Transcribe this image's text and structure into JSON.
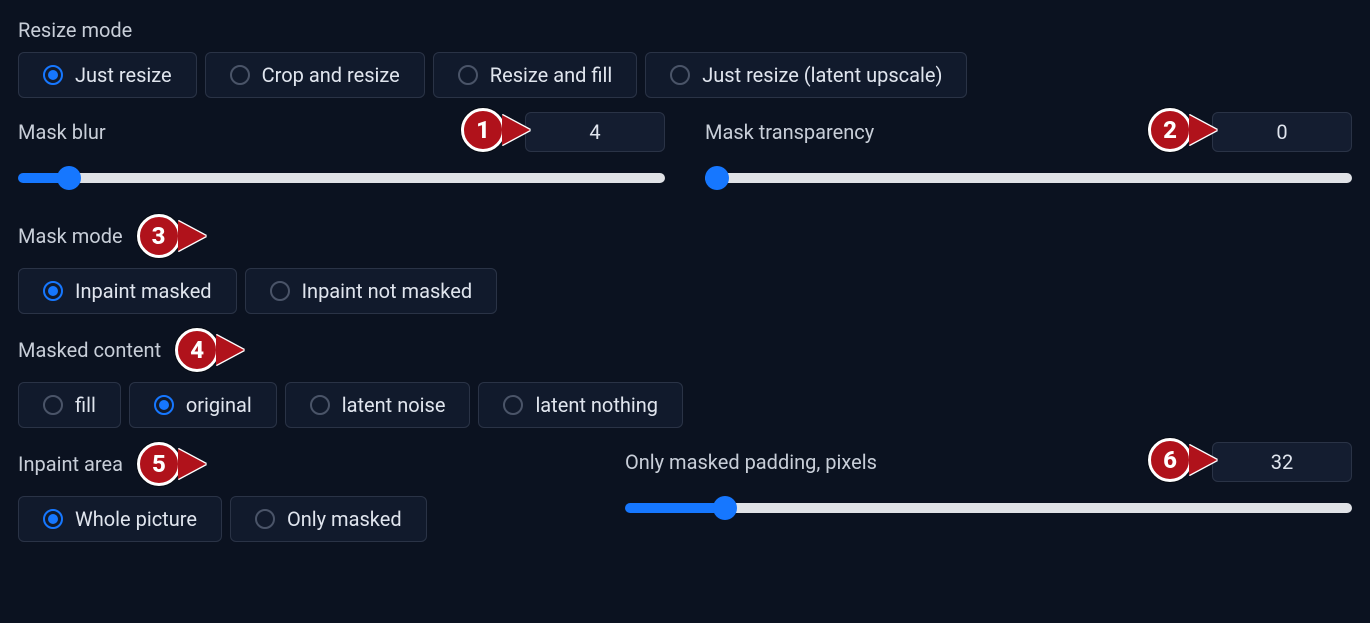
{
  "resize_mode": {
    "label": "Resize mode",
    "options": [
      {
        "label": "Just resize",
        "selected": true
      },
      {
        "label": "Crop and resize",
        "selected": false
      },
      {
        "label": "Resize and fill",
        "selected": false
      },
      {
        "label": "Just resize (latent upscale)",
        "selected": false
      }
    ]
  },
  "mask_blur": {
    "label": "Mask blur",
    "value": "4",
    "min": 0,
    "max": 64
  },
  "mask_transparency": {
    "label": "Mask transparency",
    "value": "0",
    "min": 0,
    "max": 100
  },
  "mask_mode": {
    "label": "Mask mode",
    "options": [
      {
        "label": "Inpaint masked",
        "selected": true
      },
      {
        "label": "Inpaint not masked",
        "selected": false
      }
    ]
  },
  "masked_content": {
    "label": "Masked content",
    "options": [
      {
        "label": "fill",
        "selected": false
      },
      {
        "label": "original",
        "selected": true
      },
      {
        "label": "latent noise",
        "selected": false
      },
      {
        "label": "latent nothing",
        "selected": false
      }
    ]
  },
  "inpaint_area": {
    "label": "Inpaint area",
    "options": [
      {
        "label": "Whole picture",
        "selected": true
      },
      {
        "label": "Only masked",
        "selected": false
      }
    ]
  },
  "only_masked_padding": {
    "label": "Only masked padding, pixels",
    "value": "32",
    "min": 0,
    "max": 256
  },
  "callouts": {
    "c1": "1",
    "c2": "2",
    "c3": "3",
    "c4": "4",
    "c5": "5",
    "c6": "6"
  },
  "colors": {
    "accent": "#1677ff",
    "callout": "#b0121b"
  }
}
